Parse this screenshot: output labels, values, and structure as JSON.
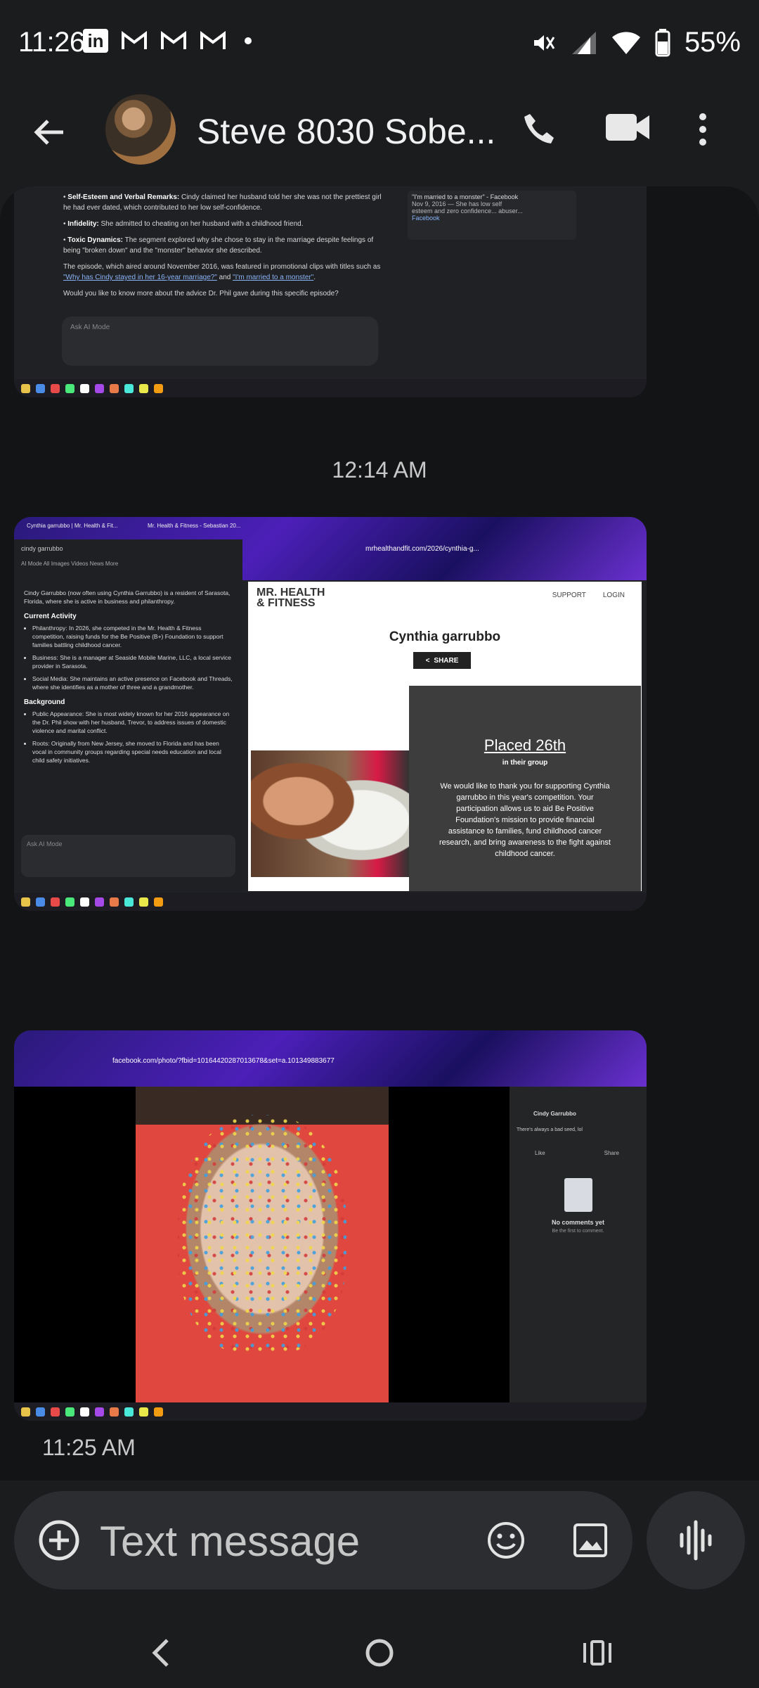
{
  "status_bar": {
    "time": "11:26",
    "battery": "55%",
    "left_icons": [
      "linkedin-icon",
      "gmail-icon",
      "gmail-icon",
      "gmail-icon",
      "dot-icon"
    ],
    "right_icons": [
      "mute-icon",
      "signal-icon",
      "wifi-icon",
      "battery-icon"
    ]
  },
  "header": {
    "contact_name": "Steve 8030 Sobe..."
  },
  "messages": {
    "screenshot1": {
      "bullets": [
        {
          "label": "Self-Esteem and Verbal Remarks:",
          "text": "Cindy claimed her husband told her she was not the prettiest girl he had ever dated, which contributed to her low self-confidence."
        },
        {
          "label": "Infidelity:",
          "text": "She admitted to cheating on her husband with a childhood friend."
        },
        {
          "label": "Toxic Dynamics:",
          "text": "The segment explored why she chose to stay in the marriage despite feelings of being \"broken down\" and the \"monster\" behavior she described."
        }
      ],
      "paragraph": "The episode, which aired around November 2016, was featured in promotional clips with titles such as",
      "link1": "\"Why has Cindy stayed in her 16-year marriage?\"",
      "link2": "\"I'm married to a monster\"",
      "question": "Would you like to know more about the advice Dr. Phil gave during this specific episode?",
      "ask_placeholder": "Ask AI Mode",
      "card_title": "\"I'm married to a monster\" - Facebook",
      "card_sub": "Nov 9, 2016 — She has low self esteem and zero confidence... abuser...",
      "card_source": "Facebook"
    },
    "timestamp_1": "12:14 AM",
    "screenshot2": {
      "tab1": "Cynthia garrubbo | Mr. Health & Fit...",
      "tab2": "Mr. Health & Fitness - Sebastian 20...",
      "url": "mrhealthandfit.com/2026/cynthia-g...",
      "search_query": "cindy garrubbo",
      "mode_tabs": "AI Mode   All   Images   Videos   News   More",
      "intro": "Cindy Garrubbo (now often using Cynthia Garrubbo) is a resident of Sarasota, Florida, where she is active in business and philanthropy.",
      "h_current": "Current Activity",
      "current": [
        "Philanthropy: In 2026, she competed in the Mr. Health & Fitness competition, raising funds for the Be Positive (B+) Foundation to support families battling childhood cancer.",
        "Business: She is a manager at Seaside Mobile Marine, LLC, a local service provider in Sarasota.",
        "Social Media: She maintains an active presence on Facebook and Threads, where she identifies as a mother of three and a grandmother."
      ],
      "h_background": "Background",
      "background": [
        "Public Appearance: She is most widely known for her 2016 appearance on the Dr. Phil show with her husband, Trevor, to address issues of domestic violence and marital conflict.",
        "Roots: Originally from New Jersey, she moved to Florida and has been vocal in community groups regarding special needs education and local child safety initiatives."
      ],
      "ask_placeholder": "Ask AI Mode",
      "logo_line1": "MR. HEALTH",
      "logo_line2": "& FITNESS",
      "nav_support": "SUPPORT",
      "nav_login": "LOGIN",
      "page_title": "Cynthia garrubbo",
      "share_label": "SHARE",
      "placed": "Placed 26th",
      "in_group": "in their group",
      "thanks": "We would like to thank you for supporting Cynthia garrubbo in this year's competition. Your participation allows us to aid Be Positive Foundation's mission to provide financial assistance to families, fund childhood cancer research, and bring awareness to the fight against childhood cancer."
    },
    "screenshot3": {
      "url": "facebook.com/photo/?fbid=10164420287013678&set=a.101349883677",
      "poster": "Cindy Garrubbo",
      "caption": "There's always a bad seed, lol",
      "like": "Like",
      "share": "Share",
      "no_comments": "No comments yet",
      "be_first": "Be the first to comment."
    },
    "timestamp_2": "11:25 AM"
  },
  "compose": {
    "placeholder": "Text message"
  },
  "colors": {
    "background": "#1a1c1e",
    "thread": "#131416",
    "compose": "#2b2d31"
  }
}
